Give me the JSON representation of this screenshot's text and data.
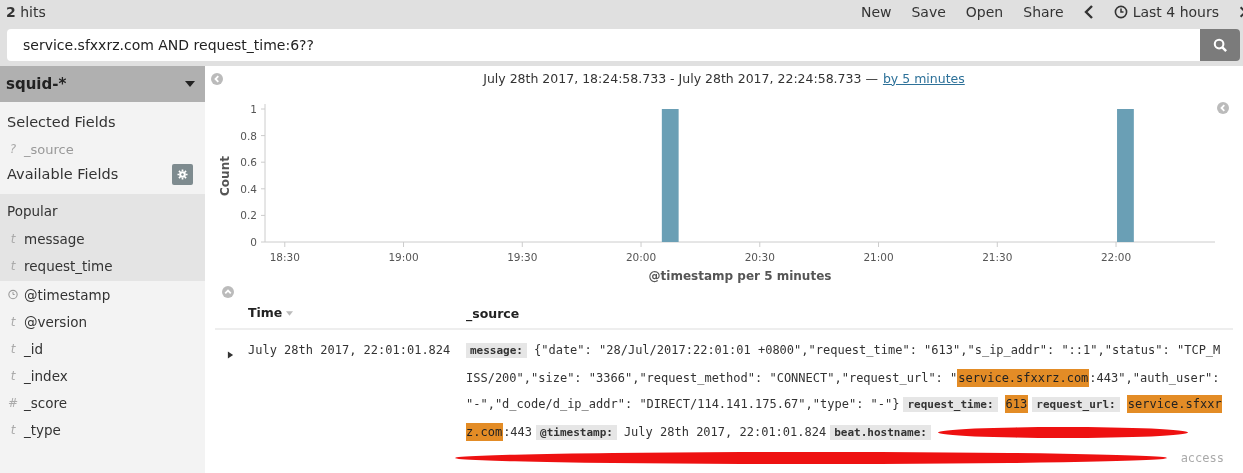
{
  "topbar": {
    "hits": "**2** hits",
    "menu": [
      "New",
      "Save",
      "Open",
      "Share"
    ],
    "time_range": "Last 4 hours"
  },
  "search": {
    "value": "service.sfxxrz.com AND request_time:6??"
  },
  "sidebar": {
    "index_pattern": "squid-*",
    "selected_title": "Selected Fields",
    "selected": [
      {
        "kind": "glyph",
        "icon": "?",
        "name": "_source"
      }
    ],
    "available_title": "Available Fields",
    "popular_title": "Popular",
    "popular": [
      {
        "kind": "glyph",
        "icon": "t",
        "name": "message"
      },
      {
        "kind": "glyph",
        "icon": "t",
        "name": "request_time"
      }
    ],
    "fields": [
      {
        "kind": "clock",
        "name": "@timestamp"
      },
      {
        "kind": "glyph",
        "icon": "t",
        "name": "@version"
      },
      {
        "kind": "glyph",
        "icon": "t",
        "name": "_id"
      },
      {
        "kind": "glyph",
        "icon": "t",
        "name": "_index"
      },
      {
        "kind": "glyph",
        "icon": "#",
        "name": "_score"
      },
      {
        "kind": "glyph",
        "icon": "t",
        "name": "_type"
      }
    ]
  },
  "range": {
    "text": "July 28th 2017, 18:24:58.733 - July 28th 2017, 22:24:58.733 —",
    "link": "by 5 minutes"
  },
  "chart_data": {
    "type": "bar",
    "xlabel": "@timestamp per 5 minutes",
    "ylabel": "Count",
    "categories": [
      null,
      "18:30",
      null,
      null,
      null,
      null,
      null,
      "19:00",
      null,
      null,
      null,
      null,
      null,
      "19:30",
      null,
      null,
      null,
      null,
      null,
      "20:00",
      null,
      null,
      null,
      null,
      null,
      "20:30",
      null,
      null,
      null,
      null,
      null,
      "21:00",
      null,
      null,
      null,
      null,
      null,
      "21:30",
      null,
      null,
      null,
      null,
      null,
      "22:00",
      null,
      null,
      null,
      null
    ],
    "series": [
      {
        "color": "#6a9fb5",
        "values": [
          0,
          0,
          0,
          0,
          0,
          0,
          0,
          0,
          0,
          0,
          0,
          0,
          0,
          0,
          0,
          0,
          0,
          0,
          0,
          0,
          1,
          0,
          0,
          0,
          0,
          0,
          0,
          0,
          0,
          0,
          0,
          0,
          0,
          0,
          0,
          0,
          0,
          0,
          0,
          0,
          0,
          0,
          0,
          1,
          0,
          0,
          0,
          0
        ]
      }
    ],
    "ylim": [
      0,
      1
    ],
    "yticks": [
      0,
      0.2,
      0.4,
      0.6,
      0.8,
      1
    ]
  },
  "table": {
    "columns": [
      "Time",
      "_source"
    ],
    "rows": [
      {
        "expanded": false,
        "time": "July 28th 2017, 22:01:01.824",
        "source": [
          {
            "kind": "label",
            "text": "message:"
          },
          {
            "kind": "text",
            "text": "{\"date\": \"28/Jul/2017:22:01:01 +0800\",\"request_time\": \"613\",\"s_ip_addr\": \"::1\",\"status\": \"TCP_MISS/200\",\"size\": \"3366\",\"request_method\": \"CONNECT\",\"request_url\": \""
          },
          {
            "kind": "highlight",
            "text": "service.sfxxrz.com"
          },
          {
            "kind": "text",
            "text": ":443\",\"auth_user\": \"-\",\"d_code/d_ip_addr\": \"DIRECT/114.141.175.67\",\"type\": \"-\"}"
          },
          {
            "kind": "label",
            "text": "request_time:"
          },
          {
            "kind": "highlight",
            "text": "613"
          },
          {
            "kind": "label",
            "text": "request_url:"
          },
          {
            "kind": "highlight",
            "text": "service.sfxxrz.com"
          },
          {
            "kind": "text",
            "text": ":443"
          },
          {
            "kind": "label",
            "text": "@timestamp:"
          },
          {
            "kind": "text",
            "text": "July 28th 2017, 22:01:01.824"
          },
          {
            "kind": "label",
            "text": "beat.hostname:"
          },
          {
            "kind": "redacted"
          }
        ],
        "last_line": "access"
      }
    ]
  }
}
